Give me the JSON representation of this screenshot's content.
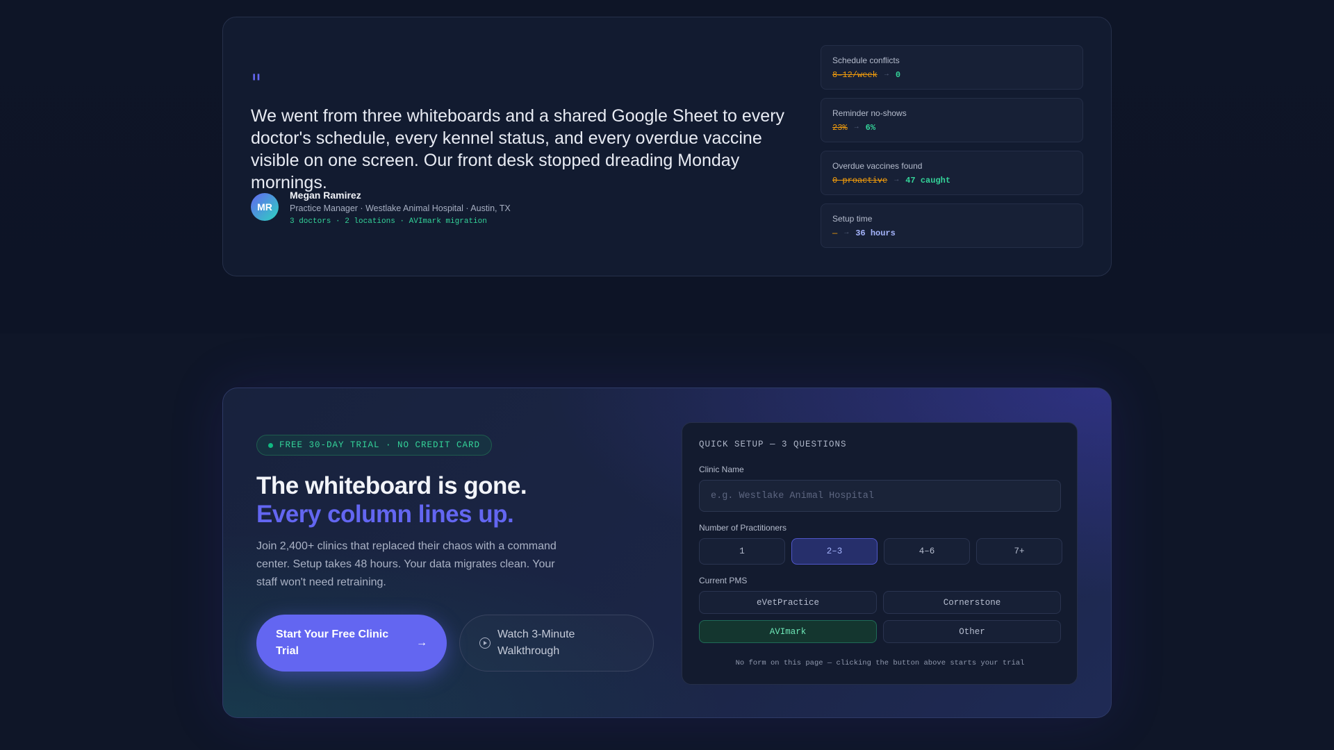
{
  "testimonial": {
    "quote_mark": "\"",
    "quote": "We went from three whiteboards and a shared Google Sheet to every doctor's schedule, every kennel status, and every overdue vaccine visible on one screen. Our front desk stopped dreading Monday mornings.",
    "author": {
      "initials": "MR",
      "name": "Megan Ramirez",
      "role": "Practice Manager · Westlake Animal Hospital · Austin, TX",
      "meta": "3 doctors · 2 locations · AVImark migration"
    },
    "metrics": [
      {
        "label": "Schedule conflicts",
        "before": "8–12/week",
        "after": "0"
      },
      {
        "label": "Reminder no-shows",
        "before": "23%",
        "after": "6%"
      },
      {
        "label": "Overdue vaccines found",
        "before": "0 proactive",
        "after": "47 caught"
      },
      {
        "label": "Setup time",
        "before": "—",
        "after": "36 hours"
      }
    ],
    "arrow": "→"
  },
  "cta": {
    "badge": "FREE 30-DAY TRIAL · NO CREDIT CARD",
    "headline_line1": "The whiteboard is gone.",
    "headline_line2": "Every column lines up.",
    "body": "Join 2,400+ clinics that replaced their chaos with a command center. Setup takes 48 hours. Your data migrates clean. Your staff won't need retraining.",
    "primary_button": "Start Your Free Clinic Trial",
    "primary_arrow": "→",
    "secondary_button": "Watch 3-Minute Walkthrough"
  },
  "setup": {
    "title": "QUICK SETUP — 3 QUESTIONS",
    "clinic_name_label": "Clinic Name",
    "clinic_name_placeholder": "e.g. Westlake Animal Hospital",
    "clinic_name_value": "",
    "practitioners_label": "Number of Practitioners",
    "practitioner_options": [
      "1",
      "2–3",
      "4–6",
      "7+"
    ],
    "practitioner_selected": "2–3",
    "pms_label": "Current PMS",
    "pms_options": [
      "eVetPractice",
      "Cornerstone",
      "AVImark",
      "Other"
    ],
    "pms_selected": "AVImark",
    "note": "No form on this page — clicking the button above starts your trial"
  },
  "colors": {
    "accent": "#6366f1",
    "success": "#34d399",
    "warning": "#f59e0b",
    "background": "#0f1628"
  }
}
